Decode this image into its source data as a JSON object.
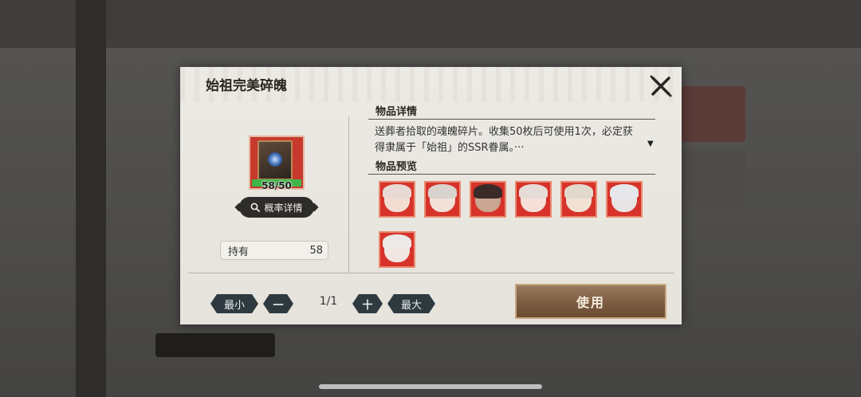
{
  "modal": {
    "title": "始祖完美碎魄",
    "item": {
      "count_text": "58/50",
      "progress": 1.0
    },
    "probability_button": "概率详情",
    "holdings": {
      "label": "持有",
      "value": "58"
    },
    "details": {
      "heading": "物品详情",
      "description": "送葬者拾取的魂魄碎片。收集50枚后可使用1次，必定获得隶属于「始祖」的SSR眷属。···"
    },
    "preview": {
      "heading": "物品预览",
      "portraits": [
        {
          "name": "portrait-1",
          "hair": "#e8d9d4",
          "skin": "#f3ddd2"
        },
        {
          "name": "portrait-2",
          "hair": "#d8d3cc",
          "skin": "#f1e1d6"
        },
        {
          "name": "portrait-3",
          "hair": "#3a2a28",
          "skin": "#caa592"
        },
        {
          "name": "portrait-4",
          "hair": "#e7dbd8",
          "skin": "#f4e0d8"
        },
        {
          "name": "portrait-5",
          "hair": "#e3d8cc",
          "skin": "#f2e2d4"
        },
        {
          "name": "portrait-6",
          "hair": "#e6e7ea",
          "skin": "#e8e3e4"
        },
        {
          "name": "portrait-7",
          "hair": "#eceae8",
          "skin": "#f2e6e2"
        }
      ]
    },
    "controls": {
      "min_label": "最小",
      "minus_label": "一",
      "page": "1/1",
      "plus_label": "十",
      "max_label": "最大"
    },
    "use_button": "使用"
  },
  "colors": {
    "rarity_red": "#d7332a",
    "progress_green": "#3fb648",
    "use_button_brown": "#7a5a3f"
  }
}
